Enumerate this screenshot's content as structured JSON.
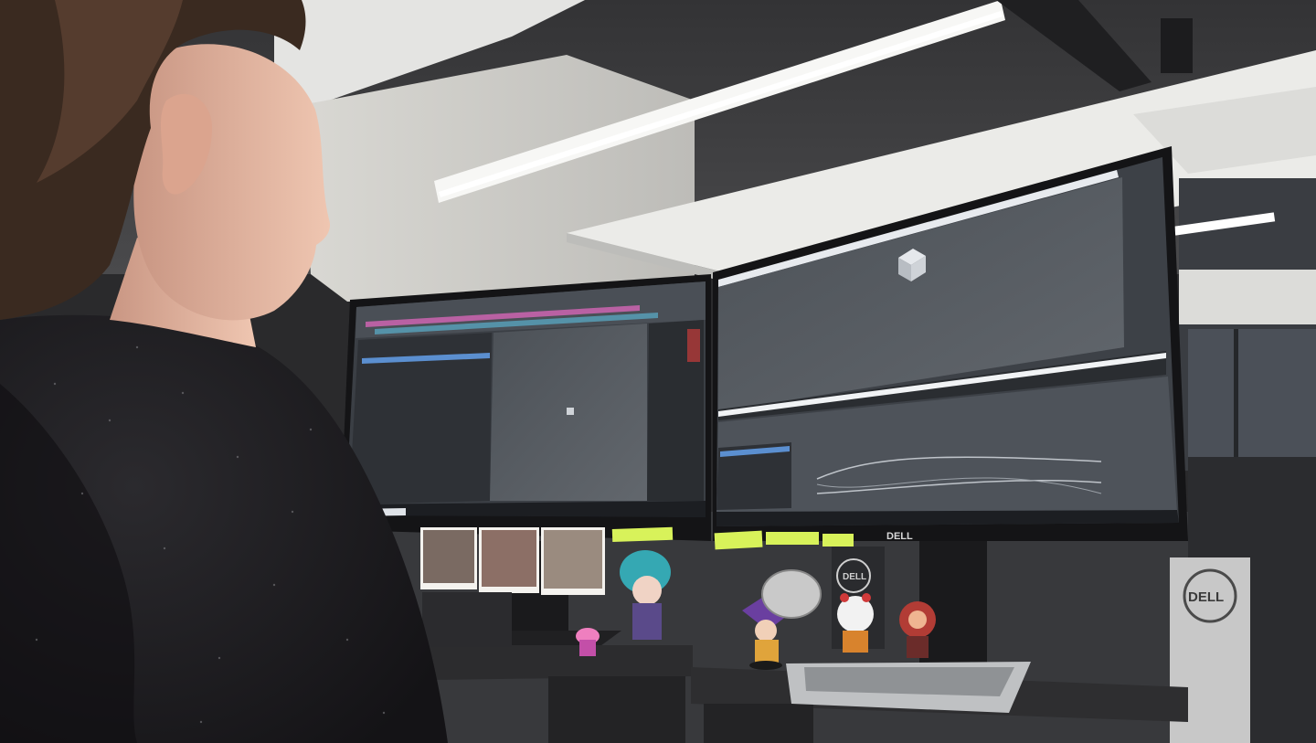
{
  "scene": {
    "description_tag": "office-desk-photo",
    "colors": {
      "ceiling": "#3b3b3d",
      "wall": "#d6d6d2",
      "ceiling_panel": "#ececea",
      "monitor_bezel": "#141416",
      "screen_ui": "#3d4147",
      "viewport": "#555a60",
      "desk": "#2c2c2e",
      "sweater": "#1d1c1f",
      "skin": "#e6b8a2",
      "hair": "#3a2a20",
      "sticky_note": "#d8f25a",
      "light": "#ffffff"
    }
  },
  "monitor_right": {
    "brand": "DELL"
  },
  "monitor_stand": {
    "brand": "DELL"
  },
  "desk_box": {
    "brand": "DELL"
  },
  "icons": [
    "dell-logo-icon",
    "cube-icon"
  ]
}
